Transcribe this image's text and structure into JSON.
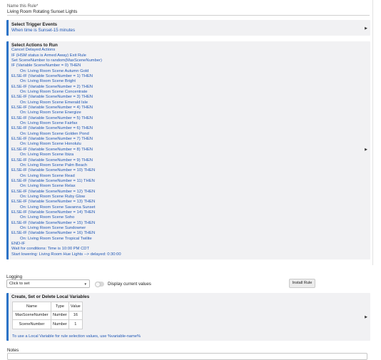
{
  "rule_name": {
    "label": "Name this Rule*",
    "value": "Living Room Rotating Sunset Lights"
  },
  "trigger_section": {
    "title": "Select Trigger Events",
    "value": "When time is Sunset-15 minutes"
  },
  "actions_section": {
    "title": "Select Actions to Run",
    "lines": [
      {
        "text": "Cancel Delayed Actions",
        "indent": 0
      },
      {
        "text": "IF (HSM status is Armed Away) Exit Rule",
        "indent": 0
      },
      {
        "text": "Set SceneNumber to random(MaxSceneNumber)",
        "indent": 0
      },
      {
        "text": "IF (Variable SceneNumber = 0) THEN",
        "indent": 0
      },
      {
        "text": "On: Living Room Scene Autumn Gold",
        "indent": 1
      },
      {
        "text": "ELSE-IF (Variable SceneNumber = 1) THEN",
        "indent": 0
      },
      {
        "text": "On: Living Room Scene Bright",
        "indent": 1
      },
      {
        "text": "ELSE-IF (Variable SceneNumber = 2) THEN",
        "indent": 0
      },
      {
        "text": "On: Living Room Scene Concentrate",
        "indent": 1
      },
      {
        "text": "ELSE-IF (Variable SceneNumber = 3) THEN",
        "indent": 0
      },
      {
        "text": "On: Living Room Scene Emerald Isle",
        "indent": 1
      },
      {
        "text": "ELSE-IF (Variable SceneNumber = 4) THEN",
        "indent": 0
      },
      {
        "text": "On: Living Room Scene Energize",
        "indent": 1
      },
      {
        "text": "ELSE-IF (Variable SceneNumber = 5) THEN",
        "indent": 0
      },
      {
        "text": "On: Living Room Scene Fairfax",
        "indent": 1
      },
      {
        "text": "ELSE-IF (Variable SceneNumber = 6) THEN",
        "indent": 0
      },
      {
        "text": "On: Living Room Scene Golden Pond",
        "indent": 1
      },
      {
        "text": "ELSE-IF (Variable SceneNumber = 7) THEN",
        "indent": 0
      },
      {
        "text": "On: Living Room Scene Honolulu",
        "indent": 1
      },
      {
        "text": "ELSE-IF (Variable SceneNumber = 8) THEN",
        "indent": 0
      },
      {
        "text": "On: Living Room Scene Ibiza",
        "indent": 1
      },
      {
        "text": "ELSE-IF (Variable SceneNumber = 9) THEN",
        "indent": 0
      },
      {
        "text": "On: Living Room Scene Palm Beach",
        "indent": 1
      },
      {
        "text": "ELSE-IF (Variable SceneNumber = 10) THEN",
        "indent": 0
      },
      {
        "text": "On: Living Room Scene Read",
        "indent": 1
      },
      {
        "text": "ELSE-IF (Variable SceneNumber = 11) THEN",
        "indent": 0
      },
      {
        "text": "On: Living Room Scene Relax",
        "indent": 1
      },
      {
        "text": "ELSE-IF (Variable SceneNumber = 12) THEN",
        "indent": 0
      },
      {
        "text": "On: Living Room Scene Ruby Glow",
        "indent": 1
      },
      {
        "text": "ELSE-IF (Variable SceneNumber = 13) THEN",
        "indent": 0
      },
      {
        "text": "On: Living Room Scene Savanna Sunset",
        "indent": 1
      },
      {
        "text": "ELSE-IF (Variable SceneNumber = 14) THEN",
        "indent": 0
      },
      {
        "text": "On: Living Room Scene Soho",
        "indent": 1
      },
      {
        "text": "ELSE-IF (Variable SceneNumber = 15) THEN",
        "indent": 0
      },
      {
        "text": "On: Living Room Scene Sundowner",
        "indent": 1
      },
      {
        "text": "ELSE-IF (Variable SceneNumber = 16) THEN",
        "indent": 0
      },
      {
        "text": "On: Living Room Scene Tropical Twilite",
        "indent": 1
      },
      {
        "text": "END-IF",
        "indent": 0
      },
      {
        "text": "Wait for conditions: Time is 10:00 PM CDT",
        "indent": 0
      },
      {
        "text": "Start lowering: Living Room Hue Lights --> delayed: 0:30:00",
        "indent": 0
      }
    ]
  },
  "logging": {
    "label": "Logging",
    "select_value": "Click to set"
  },
  "display_current_values": {
    "label": "Display current values",
    "enabled": false
  },
  "install_button": {
    "label": "Install Rule"
  },
  "local_variables": {
    "title": "Create, Set or Delete Local Variables",
    "headers": [
      "Name",
      "Type",
      "Value"
    ],
    "rows": [
      [
        "MaxSceneNumber",
        "Number",
        "16"
      ],
      [
        "SceneNumber",
        "Number",
        "1"
      ]
    ],
    "note": "To use a Local Variable for rule selection values, use %variable-name%"
  },
  "notes": {
    "label": "Notes"
  },
  "icons": {
    "section_expand": "triangle-right-icon",
    "select_caret": "triangle-down-icon"
  },
  "colors": {
    "accent": "#2b73c7",
    "link_text": "#1f57b5",
    "section_bg": "#f1f1f3"
  }
}
